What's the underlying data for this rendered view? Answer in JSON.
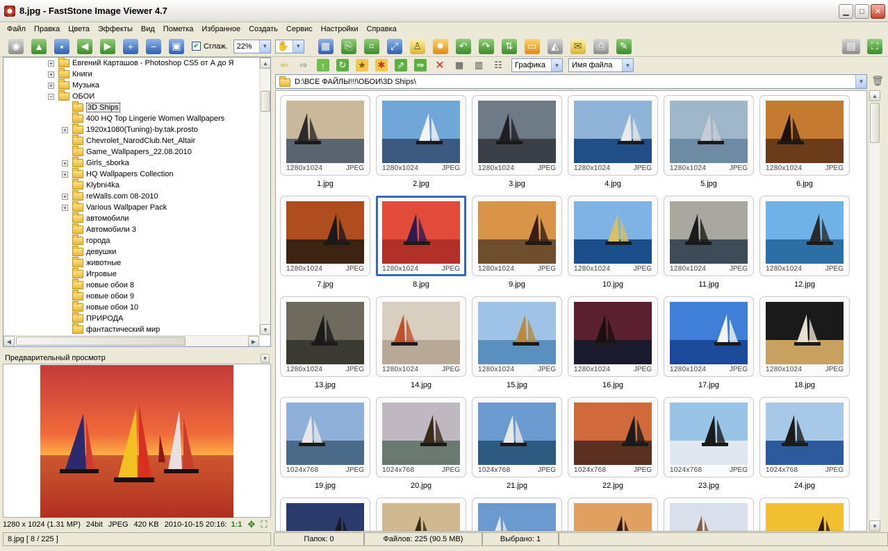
{
  "window": {
    "title": "8.jpg  -  FastStone Image Viewer 4.7",
    "minimize_icon": "minimize-icon",
    "maximize_icon": "maximize-icon",
    "close_icon": "close-icon"
  },
  "menu": [
    "Файл",
    "Правка",
    "Цвета",
    "Эффекты",
    "Вид",
    "Пометка",
    "Избранное",
    "Создать",
    "Сервис",
    "Настройки",
    "Справка"
  ],
  "toolbar": {
    "smooth_label": "Сглаж.",
    "smooth_checked": true,
    "zoom_value": "22%"
  },
  "tree": {
    "items": [
      {
        "label": "Евгений Карташов - Photoshop CS5 от А до Я",
        "level": 0,
        "expander": "+"
      },
      {
        "label": "Книги",
        "level": 0,
        "expander": "+"
      },
      {
        "label": "Музыка",
        "level": 0,
        "expander": "+"
      },
      {
        "label": "ОБОИ",
        "level": 0,
        "expander": "-"
      },
      {
        "label": "3D Ships",
        "level": 1,
        "expander": "",
        "selected": true
      },
      {
        "label": "400 HQ Top Lingerie Women Wallpapers",
        "level": 1,
        "expander": ""
      },
      {
        "label": "1920x1080(Tuning)-by.tak.prosto",
        "level": 1,
        "expander": "+"
      },
      {
        "label": "Chevrolet_NarodClub.Net_Altair",
        "level": 1,
        "expander": ""
      },
      {
        "label": "Game_Wallpapers_22.08.2010",
        "level": 1,
        "expander": ""
      },
      {
        "label": "Girls_sborka",
        "level": 1,
        "expander": "+"
      },
      {
        "label": "HQ Wallpapers Collection",
        "level": 1,
        "expander": "+"
      },
      {
        "label": "Klybni4ka",
        "level": 1,
        "expander": ""
      },
      {
        "label": "reWalls.com 08-2010",
        "level": 1,
        "expander": "+"
      },
      {
        "label": "Various Wallpaper Pack",
        "level": 1,
        "expander": "+"
      },
      {
        "label": "автомобили",
        "level": 1,
        "expander": ""
      },
      {
        "label": "Автомобили 3",
        "level": 1,
        "expander": ""
      },
      {
        "label": "города",
        "level": 1,
        "expander": ""
      },
      {
        "label": "девушки",
        "level": 1,
        "expander": ""
      },
      {
        "label": "животные",
        "level": 1,
        "expander": ""
      },
      {
        "label": "Игровые",
        "level": 1,
        "expander": ""
      },
      {
        "label": "новые обои 8",
        "level": 1,
        "expander": ""
      },
      {
        "label": "новые обои 9",
        "level": 1,
        "expander": ""
      },
      {
        "label": "новые обои 10",
        "level": 1,
        "expander": ""
      },
      {
        "label": "ПРИРОДА",
        "level": 1,
        "expander": ""
      },
      {
        "label": "фантастический мир",
        "level": 1,
        "expander": ""
      }
    ]
  },
  "preview": {
    "title": "Предварительный просмотр",
    "info_resolution": "1280 x 1024 (1.31 MP)",
    "info_bits": "24bit",
    "info_format": "JPEG",
    "info_size": "420 KB",
    "info_date": "2010-10-15 20:16:",
    "info_ratio": "1:1"
  },
  "browser": {
    "filter_value": "Графика",
    "sort_value": "Имя файла",
    "address": "D:\\ВСЕ ФАЙЛЫ!!!\\ОБОИ\\3D Ships\\"
  },
  "thumbnails": [
    {
      "name": "1.jpg",
      "dims": "1280x1024",
      "fmt": "JPEG",
      "sky": "#c9b99a",
      "sea": "#5a6470",
      "accent": "#2a2a2a"
    },
    {
      "name": "2.jpg",
      "dims": "1280x1024",
      "fmt": "JPEG",
      "sky": "#6fa7d8",
      "sea": "#3c5a80",
      "accent": "#f4f4f4"
    },
    {
      "name": "3.jpg",
      "dims": "1280x1024",
      "fmt": "JPEG",
      "sky": "#6e7a86",
      "sea": "#3b4048",
      "accent": "#1f1f1f"
    },
    {
      "name": "4.jpg",
      "dims": "1280x1024",
      "fmt": "JPEG",
      "sky": "#8fb4d8",
      "sea": "#1f4f86",
      "accent": "#e8e8e8"
    },
    {
      "name": "5.jpg",
      "dims": "1280x1024",
      "fmt": "JPEG",
      "sky": "#9fb6c8",
      "sea": "#6d8aa3",
      "accent": "#c7ccd2"
    },
    {
      "name": "6.jpg",
      "dims": "1280x1024",
      "fmt": "JPEG",
      "sky": "#c47a2f",
      "sea": "#6b3a18",
      "accent": "#1e1208"
    },
    {
      "name": "7.jpg",
      "dims": "1280x1024",
      "fmt": "JPEG",
      "sky": "#b04d1c",
      "sea": "#3d2412",
      "accent": "#1a1a1a"
    },
    {
      "name": "8.jpg",
      "dims": "1280x1024",
      "fmt": "JPEG",
      "sky": "#e24a3a",
      "sea": "#b23027",
      "accent": "#2b1b4f"
    },
    {
      "name": "9.jpg",
      "dims": "1280x1024",
      "fmt": "JPEG",
      "sky": "#d89548",
      "sea": "#6e4e2c",
      "accent": "#3a1e10"
    },
    {
      "name": "10.jpg",
      "dims": "1280x1024",
      "fmt": "JPEG",
      "sky": "#7fb3e6",
      "sea": "#1b4e8a",
      "accent": "#d9c060"
    },
    {
      "name": "11.jpg",
      "dims": "1280x1024",
      "fmt": "JPEG",
      "sky": "#a8a8a0",
      "sea": "#3e4c5a",
      "accent": "#1a1a1a"
    },
    {
      "name": "12.jpg",
      "dims": "1280x1024",
      "fmt": "JPEG",
      "sky": "#6fb2e8",
      "sea": "#2c6fa5",
      "accent": "#2a2a2a"
    },
    {
      "name": "13.jpg",
      "dims": "1280x1024",
      "fmt": "JPEG",
      "sky": "#6e6a5e",
      "sea": "#3a3a30",
      "accent": "#1a1a1a"
    },
    {
      "name": "14.jpg",
      "dims": "1280x1024",
      "fmt": "JPEG",
      "sky": "#d8cfc0",
      "sea": "#b8a898",
      "accent": "#c0502a"
    },
    {
      "name": "15.jpg",
      "dims": "1280x1024",
      "fmt": "JPEG",
      "sky": "#9fc3e6",
      "sea": "#5a90c0",
      "accent": "#b88a3a"
    },
    {
      "name": "16.jpg",
      "dims": "1280x1024",
      "fmt": "JPEG",
      "sky": "#5a2030",
      "sea": "#1a1a2e",
      "accent": "#1a1010"
    },
    {
      "name": "17.jpg",
      "dims": "1280x1024",
      "fmt": "JPEG",
      "sky": "#3f7fd8",
      "sea": "#1b4a9a",
      "accent": "#f4f4f4"
    },
    {
      "name": "18.jpg",
      "dims": "1280x1024",
      "fmt": "JPEG",
      "sky": "#1a1a1a",
      "sea": "#c8a060",
      "accent": "#e8e0d0"
    },
    {
      "name": "19.jpg",
      "dims": "1024x768",
      "fmt": "JPEG",
      "sky": "#8fb0d8",
      "sea": "#4a6a8a",
      "accent": "#e8e8e8"
    },
    {
      "name": "20.jpg",
      "dims": "1024x768",
      "fmt": "JPEG",
      "sky": "#c0b8c0",
      "sea": "#6a7a70",
      "accent": "#3a2a1a"
    },
    {
      "name": "21.jpg",
      "dims": "1024x768",
      "fmt": "JPEG",
      "sky": "#6a9ad0",
      "sea": "#2c5a80",
      "accent": "#e8e8e8"
    },
    {
      "name": "22.jpg",
      "dims": "1024x768",
      "fmt": "JPEG",
      "sky": "#d06a3a",
      "sea": "#5a3020",
      "accent": "#1a1a1a"
    },
    {
      "name": "23.jpg",
      "dims": "1024x768",
      "fmt": "JPEG",
      "sky": "#9ac4e6",
      "sea": "#dfe8f0",
      "accent": "#1a1a1a"
    },
    {
      "name": "24.jpg",
      "dims": "1024x768",
      "fmt": "JPEG",
      "sky": "#a8c8e8",
      "sea": "#2c5a9a",
      "accent": "#1a1a1a"
    },
    {
      "name": "",
      "dims": "",
      "fmt": "",
      "sky": "#2a3a6a",
      "sea": "#1a1a2a",
      "accent": "#1a1a1a"
    },
    {
      "name": "",
      "dims": "",
      "fmt": "",
      "sky": "#d0b890",
      "sea": "#8a6a40",
      "accent": "#3a2a10"
    },
    {
      "name": "",
      "dims": "",
      "fmt": "",
      "sky": "#6a9ad0",
      "sea": "#3a6a90",
      "accent": "#e8e8e8"
    },
    {
      "name": "",
      "dims": "",
      "fmt": "",
      "sky": "#e0a060",
      "sea": "#a04a20",
      "accent": "#2a1a10"
    },
    {
      "name": "",
      "dims": "",
      "fmt": "",
      "sky": "#d8e0ec",
      "sea": "#a8b8d0",
      "accent": "#8a5a3a"
    },
    {
      "name": "",
      "dims": "",
      "fmt": "",
      "sky": "#f0c030",
      "sea": "#c07020",
      "accent": "#2a1a08"
    }
  ],
  "status": {
    "file_position": "8.jpg [ 8 / 225 ]",
    "folders": "Папок: 0",
    "files": "Файлов: 225 (90.5 MB)",
    "selected": "Выбрано: 1"
  },
  "colors": {
    "selection": "#316ac5",
    "window_bg": "#ece9d8"
  }
}
